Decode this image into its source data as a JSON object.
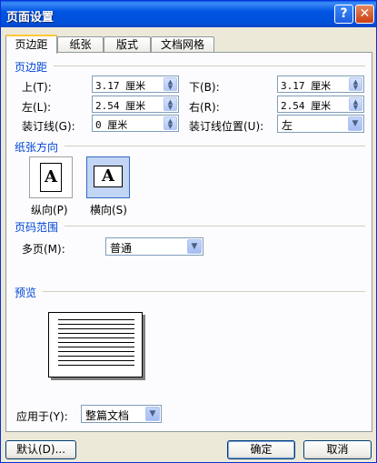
{
  "window": {
    "title": "页面设置",
    "help_label": "?",
    "close_label": "✕"
  },
  "tabs": [
    {
      "label": "页边距",
      "active": true
    },
    {
      "label": "纸张",
      "active": false
    },
    {
      "label": "版式",
      "active": false
    },
    {
      "label": "文档网格",
      "active": false
    }
  ],
  "margins": {
    "section_title": "页边距",
    "top": {
      "label": "上(T):",
      "value": "3.17 厘米"
    },
    "bottom": {
      "label": "下(B):",
      "value": "3.17 厘米"
    },
    "left": {
      "label": "左(L):",
      "value": "2.54 厘米"
    },
    "right": {
      "label": "右(R):",
      "value": "2.54 厘米"
    },
    "gutter": {
      "label": "装订线(G):",
      "value": "0 厘米"
    },
    "gutter_position": {
      "label": "装订线位置(U):",
      "value": "左"
    }
  },
  "orientation": {
    "section_title": "纸张方向",
    "portrait": {
      "label": "纵向(P)",
      "glyph": "A",
      "selected": false
    },
    "landscape": {
      "label": "横向(S)",
      "glyph": "A",
      "selected": true
    }
  },
  "pages": {
    "section_title": "页码范围",
    "multiple_label": "多页(M):",
    "multiple_value": "普通"
  },
  "preview": {
    "section_title": "预览",
    "apply_to_label": "应用于(Y):",
    "apply_to_value": "整篇文档"
  },
  "buttons": {
    "default": "默认(D)...",
    "ok": "确定",
    "cancel": "取消"
  },
  "icons": {
    "spinner": "up-down-arrows-icon",
    "dropdown": "chevron-down-icon"
  },
  "colors": {
    "title_bar": "#0054e3",
    "section_title": "#0046d5",
    "dialog_bg": "#ece9d8"
  }
}
